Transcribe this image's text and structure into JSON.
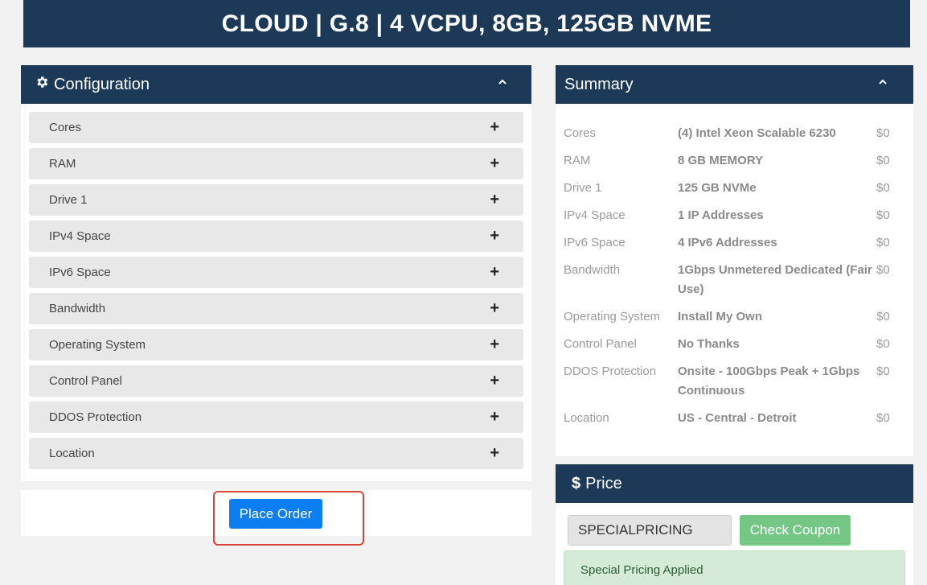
{
  "product_title": "CLOUD | G.8 | 4 VCPU, 8GB, 125GB NVME",
  "configuration": {
    "title": "Configuration",
    "items": [
      {
        "label": "Cores"
      },
      {
        "label": "RAM"
      },
      {
        "label": "Drive 1"
      },
      {
        "label": "IPv4 Space"
      },
      {
        "label": "IPv6 Space"
      },
      {
        "label": "Bandwidth"
      },
      {
        "label": "Operating System"
      },
      {
        "label": "Control Panel"
      },
      {
        "label": "DDOS Protection"
      },
      {
        "label": "Location"
      }
    ]
  },
  "place_order_label": "Place Order",
  "summary": {
    "title": "Summary",
    "rows": [
      {
        "label": "Cores",
        "value": "(4) Intel Xeon Scalable 6230",
        "price": "$0"
      },
      {
        "label": "RAM",
        "value": "8 GB MEMORY",
        "price": "$0"
      },
      {
        "label": "Drive 1",
        "value": "125 GB NVMe",
        "price": "$0"
      },
      {
        "label": "IPv4 Space",
        "value": "1 IP Addresses",
        "price": "$0"
      },
      {
        "label": "IPv6 Space",
        "value": "4 IPv6 Addresses",
        "price": "$0"
      },
      {
        "label": "Bandwidth",
        "value": "1Gbps Unmetered Dedicated (Fair Use)",
        "price": "$0"
      },
      {
        "label": "Operating System",
        "value": "Install My Own",
        "price": "$0"
      },
      {
        "label": "Control Panel",
        "value": "No Thanks",
        "price": "$0"
      },
      {
        "label": "DDOS Protection",
        "value": "Onsite - 100Gbps Peak + 1Gbps Continuous",
        "price": "$0"
      },
      {
        "label": "Location",
        "value": "US - Central - Detroit",
        "price": "$0"
      }
    ]
  },
  "price": {
    "title": "Price",
    "coupon_value": "SPECIALPRICING",
    "check_coupon_label": "Check Coupon",
    "alert": "Special Pricing Applied"
  },
  "colors": {
    "header_bg": "#1c3a57",
    "primary_button": "#0d7df2",
    "success_button": "#74c784",
    "highlight_border": "#d9443a"
  }
}
